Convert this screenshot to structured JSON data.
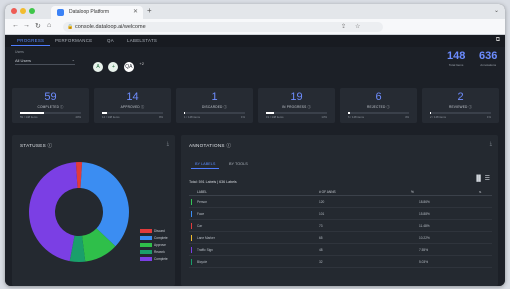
{
  "browser": {
    "tab_title": "Dataloop Platform",
    "close_glyph": "✕",
    "newtab_glyph": "+",
    "tabs_menu_glyph": "⌄",
    "url": "console.dataloop.ai/welcome",
    "icons": [
      "back-arrow-icon",
      "forward-arrow-icon",
      "reload-icon",
      "home-icon",
      "lock-icon",
      "share-icon",
      "star-icon"
    ],
    "nav_glyphs": {
      "back": "←",
      "forward": "→",
      "reload": "↻",
      "home": "⌂",
      "lock": "🔒",
      "share": "⇪",
      "star": "☆"
    },
    "traffic_lights": [
      "#ee5c55",
      "#f2bc2f",
      "#3fc64a"
    ]
  },
  "app": {
    "tabs": [
      {
        "label": "PROGRESS",
        "active": true
      },
      {
        "label": "PERFORMANCE",
        "active": false
      },
      {
        "label": "QA",
        "active": false
      },
      {
        "label": "LABELSTATS",
        "active": false
      }
    ],
    "external_icon": "external-link-icon",
    "external_glyph": "⧉",
    "accent": "#4f7dff",
    "filter": {
      "label": "Users",
      "value": "All Users",
      "chevron": "⌄"
    },
    "chips": [
      {
        "glyph": "A",
        "bg": "#e8f2ec",
        "fg": "#1c6b3a"
      },
      {
        "glyph": "+",
        "bg": "#e8f2ec",
        "fg": "#1c6b3a"
      },
      {
        "glyph": "QA",
        "bg": "#ffffff",
        "fg": "#2a2f37"
      }
    ],
    "chip_tag": "+2",
    "stats": [
      {
        "value": "148",
        "label": "Total Items"
      },
      {
        "value": "636",
        "label": "Annotations"
      }
    ],
    "cards": [
      {
        "value": "59",
        "label": "COMPLETED ⓘ",
        "progress": 0.4,
        "left": "59 / 148 items",
        "right": "40%"
      },
      {
        "value": "14",
        "label": "APPROVED ⓘ",
        "progress": 0.09,
        "left": "14 / 148 items",
        "right": "9%"
      },
      {
        "value": "1",
        "label": "DISCARDED ⓘ",
        "progress": 0.01,
        "left": "1 / 148 items",
        "right": "1%"
      },
      {
        "value": "19",
        "label": "IN PROGRESS ⓘ",
        "progress": 0.13,
        "left": "19 / 148 items",
        "right": "13%"
      },
      {
        "value": "6",
        "label": "REJECTED ⓘ",
        "progress": 0.04,
        "left": "6 / 148 items",
        "right": "4%"
      },
      {
        "value": "2",
        "label": "REVIEWED ⓘ",
        "progress": 0.01,
        "left": "2 / 148 items",
        "right": "1%"
      }
    ],
    "statuses": {
      "title": "STATUSES ⓘ",
      "download_glyph": "⤓",
      "legend": [
        {
          "label": "Discard",
          "color": "#e23b3b"
        },
        {
          "label": "Complete",
          "color": "#3b8df2"
        },
        {
          "label": "Approve",
          "color": "#2fbf4a"
        },
        {
          "label": "Rework",
          "color": "#1a9f6b"
        },
        {
          "label": "Complete",
          "color": "#7b3fe4"
        }
      ]
    },
    "annotations": {
      "title": "ANNOTATIONS ⓘ",
      "download_glyph": "⤓",
      "subtabs": [
        {
          "label": "BY LABELS",
          "active": true
        },
        {
          "label": "BY TOOLS",
          "active": false
        }
      ],
      "total": "Total: 591 Labels | 636 Labels",
      "view_icons": [
        "bar-chart-icon",
        "list-view-icon"
      ],
      "view_glyphs": {
        "chart": "▐▌",
        "list": "☰"
      },
      "columns": [
        "LABEL",
        "# OF ANNS",
        "%"
      ],
      "sort_glyph": "⇅",
      "rows": [
        {
          "label": "Person",
          "count": "120",
          "pct": "18.86%",
          "color": "#34c759"
        },
        {
          "label": "Face",
          "count": "101",
          "pct": "15.88%",
          "color": "#3b8df2"
        },
        {
          "label": "Car",
          "count": "73",
          "pct": "11.48%",
          "color": "#e23b3b"
        },
        {
          "label": "Lane Marker",
          "count": "65",
          "pct": "10.22%",
          "color": "#f2bc2f"
        },
        {
          "label": "Traffic Sign",
          "count": "48",
          "pct": "7.55%",
          "color": "#7b3fe4"
        },
        {
          "label": "Bicycle",
          "count": "32",
          "pct": "5.03%",
          "color": "#1a9f6b"
        }
      ]
    }
  },
  "chart_data": {
    "type": "pie",
    "labels": [
      "Discard",
      "Complete",
      "Approve",
      "Rework",
      "Complete"
    ],
    "values": [
      2,
      36,
      11,
      5,
      46
    ]
  }
}
